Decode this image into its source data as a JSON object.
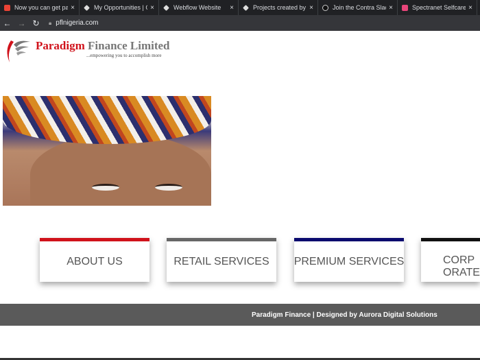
{
  "browser": {
    "tabs": [
      {
        "title": "Now you can get paid",
        "icon": "gmail-icon",
        "color": "#ea4335"
      },
      {
        "title": "My Opportunities | Co",
        "icon": "contra-icon",
        "color": "#ddd"
      },
      {
        "title": "Webflow Website",
        "icon": "contra-icon",
        "color": "#ddd"
      },
      {
        "title": "Projects created by Pa",
        "icon": "contra-icon",
        "color": "#ddd"
      },
      {
        "title": "Join the Contra Slack",
        "icon": "circle-icon",
        "color": "#111"
      },
      {
        "title": "Spectranet Selfcare",
        "icon": "spectranet-icon",
        "color": "#e8457a"
      }
    ],
    "close": "×",
    "url": "pflnigeria.com"
  },
  "header": {
    "brand_red": "Paradigm",
    "brand_gray": "Finance Limited",
    "tagline": "...empowering you to accomplish more"
  },
  "services": [
    {
      "label": "ABOUT US",
      "color": "#d0121b"
    },
    {
      "label": "RETAIL SERVICES",
      "color": "#666666"
    },
    {
      "label": "PREMIUM SERVICES",
      "color": "#0a0a6e"
    },
    {
      "label": "CORPORATE",
      "color": "#111111"
    }
  ],
  "footer": {
    "text": "Paradigm Finance | Designed by Aurora Digital Solutions"
  }
}
